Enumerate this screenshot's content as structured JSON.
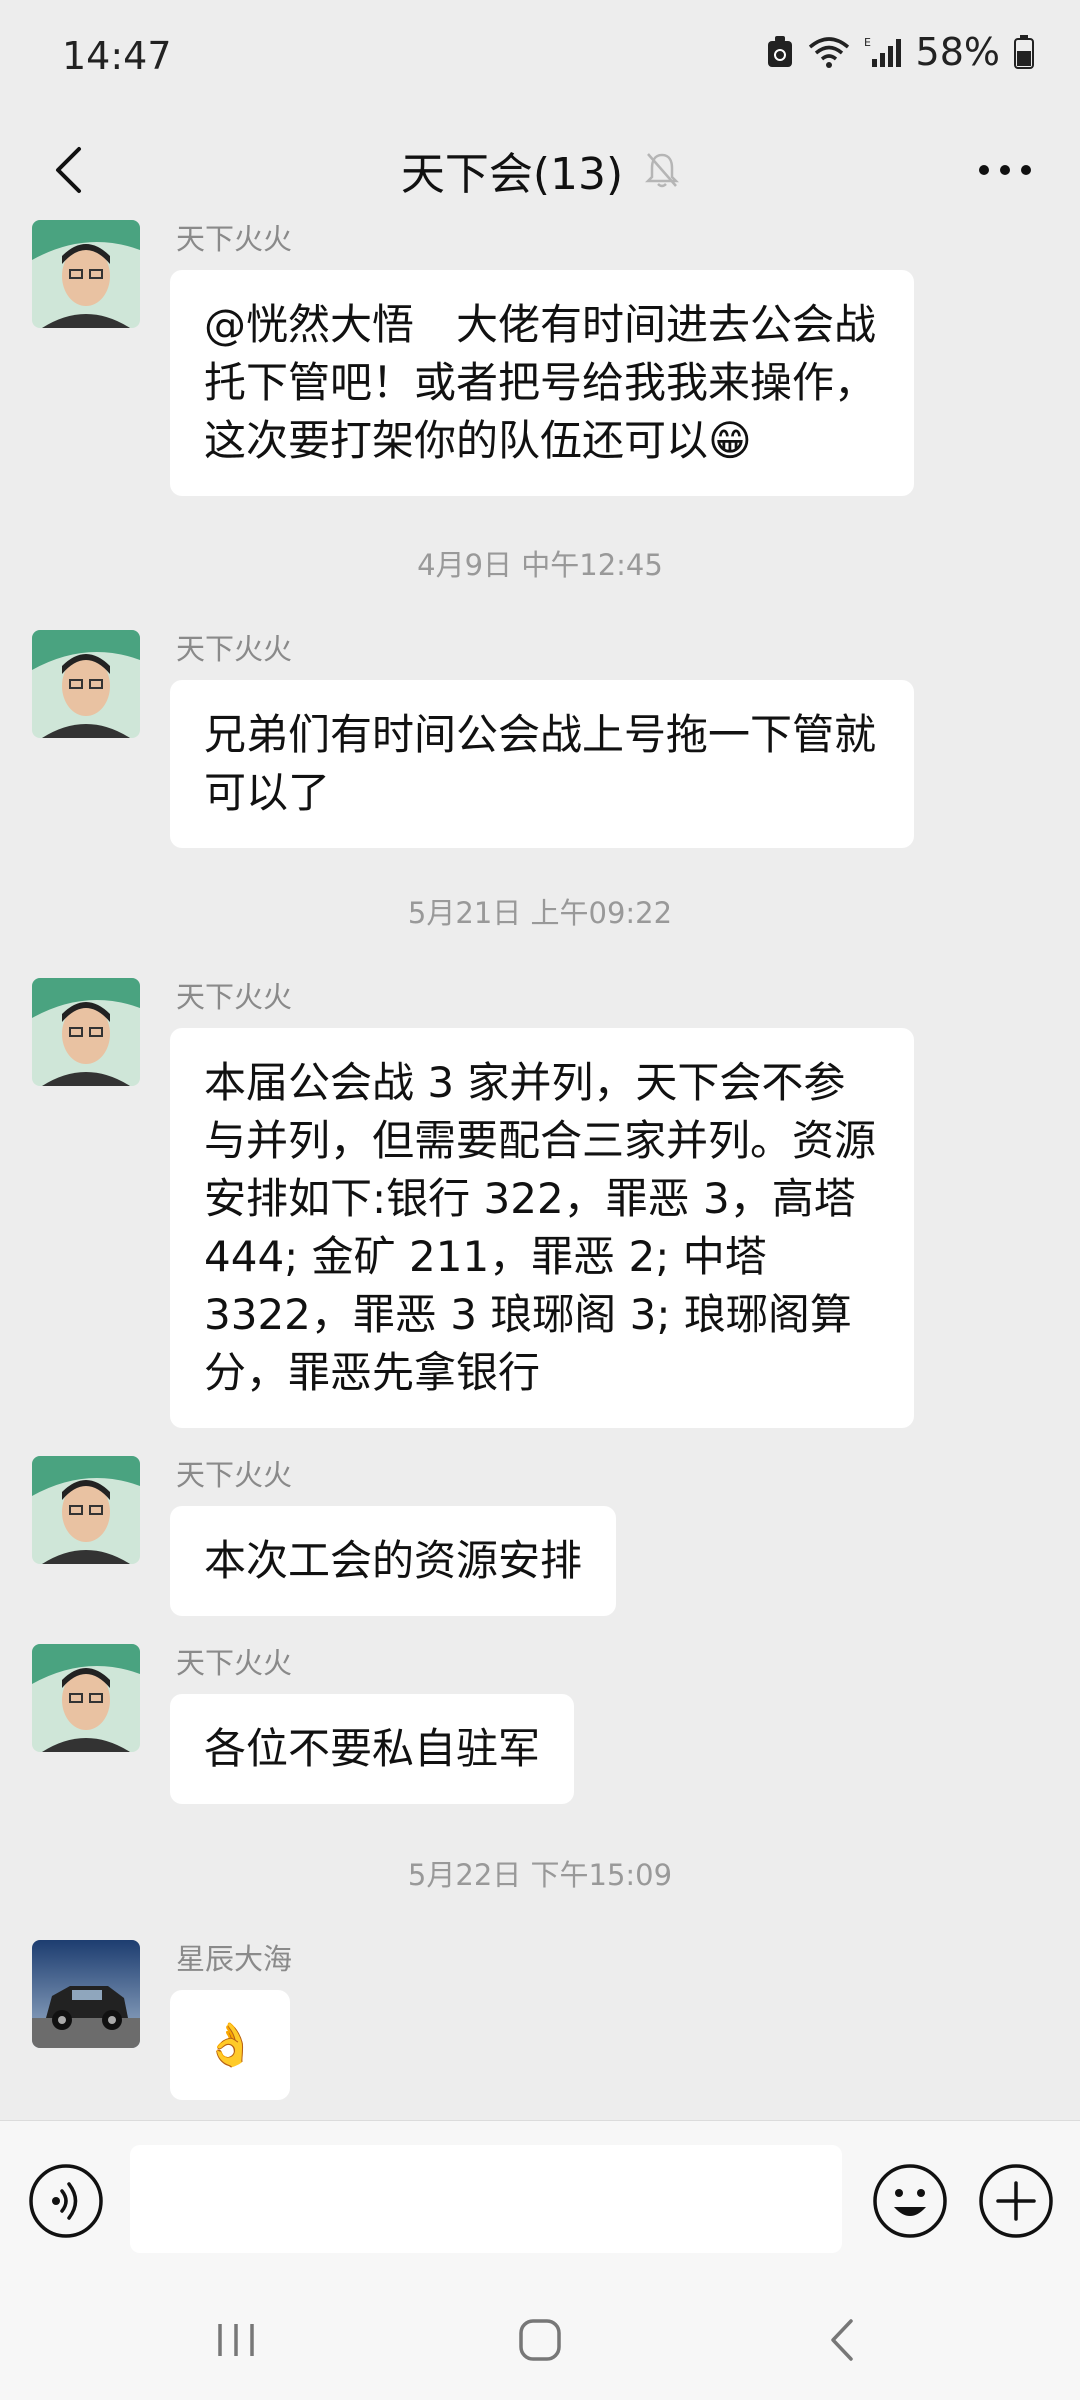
{
  "status": {
    "time": "14:47",
    "battery": "58%"
  },
  "header": {
    "title": "天下会(13)"
  },
  "messages": [
    {
      "sender": "天下火火",
      "text": "@恍然大悟　大佬有时间进去公会战托下管吧！或者把号给我我来操作，这次要打架你的队伍还可以😁"
    },
    {
      "timestamp": "4月9日 中午12:45"
    },
    {
      "sender": "天下火火",
      "text": "兄弟们有时间公会战上号拖一下管就可以了"
    },
    {
      "timestamp": "5月21日 上午09:22"
    },
    {
      "sender": "天下火火",
      "text": "本届公会战 3 家并列，天下会不参与并列，但需要配合三家并列。资源安排如下:银行 322，罪恶 3，高塔 444; 金矿 211，罪恶 2; 中塔 3322，罪恶 3 琅琊阁 3; 琅琊阁算分，罪恶先拿银行"
    },
    {
      "sender": "天下火火",
      "text": "本次工会的资源安排"
    },
    {
      "sender": "天下火火",
      "text": "各位不要私自驻军"
    },
    {
      "timestamp": "5月22日 下午15:09"
    },
    {
      "sender": "星辰大海",
      "text": "👌"
    }
  ],
  "input": {
    "value": ""
  },
  "icons": {
    "back": "chevron-left-icon",
    "mute": "bell-off-icon",
    "more": "more-dots-icon",
    "voice": "voice-icon",
    "emoji": "emoji-icon",
    "plus": "plus-icon"
  }
}
